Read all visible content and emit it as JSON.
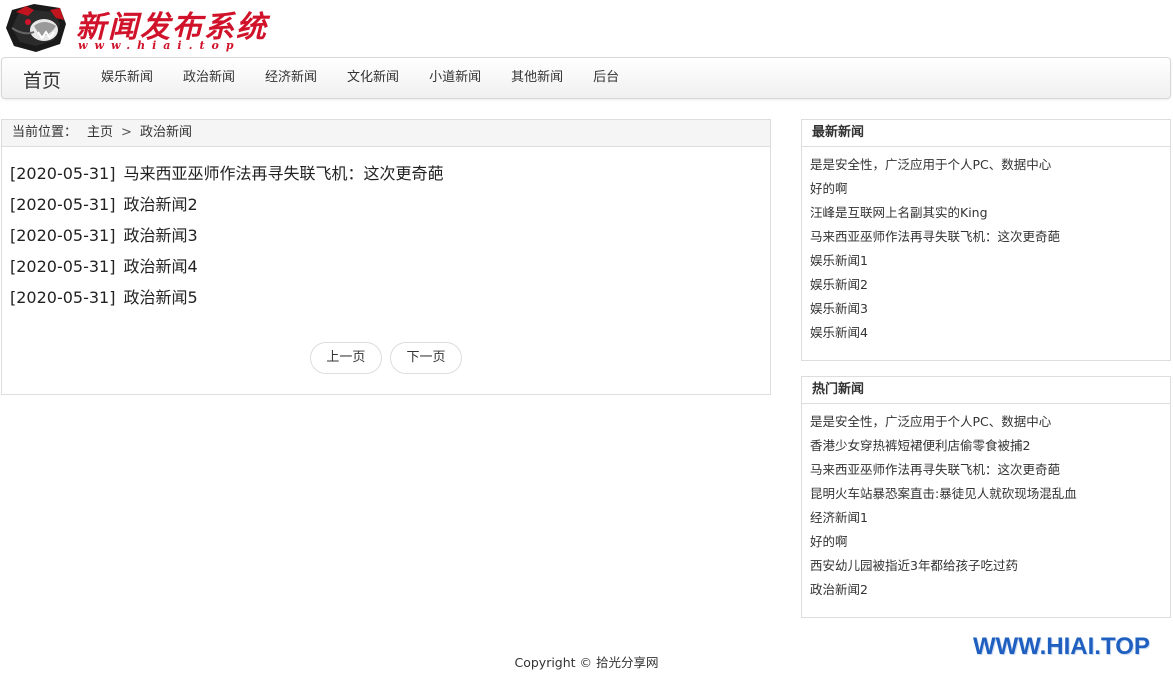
{
  "header": {
    "logo_title": "新闻发布系统",
    "logo_url": "www.hiai.top"
  },
  "navbar": {
    "brand": "首页",
    "items": [
      {
        "label": "娱乐新闻"
      },
      {
        "label": "政治新闻"
      },
      {
        "label": "经济新闻"
      },
      {
        "label": "文化新闻"
      },
      {
        "label": "小道新闻"
      },
      {
        "label": "其他新闻"
      },
      {
        "label": "后台"
      }
    ]
  },
  "breadcrumb": {
    "prefix": "当前位置：",
    "home": "主页",
    "separator": ">",
    "current": "政治新闻"
  },
  "news_list": [
    {
      "date": "[2020-05-31]",
      "title": "马来西亚巫师作法再寻失联飞机：这次更奇葩"
    },
    {
      "date": "[2020-05-31]",
      "title": "政治新闻2"
    },
    {
      "date": "[2020-05-31]",
      "title": "政治新闻3"
    },
    {
      "date": "[2020-05-31]",
      "title": "政治新闻4"
    },
    {
      "date": "[2020-05-31]",
      "title": "政治新闻5"
    }
  ],
  "pager": {
    "prev": "上一页",
    "next": "下一页"
  },
  "latest": {
    "heading": "最新新闻",
    "items": [
      "是是安全性，广泛应用于个人PC、数据中心",
      "好的啊",
      "汪峰是互联网上名副其实的King",
      "马来西亚巫师作法再寻失联飞机：这次更奇葩",
      "娱乐新闻1",
      "娱乐新闻2",
      "娱乐新闻3",
      "娱乐新闻4"
    ]
  },
  "hot": {
    "heading": "热门新闻",
    "items": [
      "是是安全性，广泛应用于个人PC、数据中心",
      "香港少女穿热裤短裙便利店偷零食被捕2",
      "马来西亚巫师作法再寻失联飞机：这次更奇葩",
      "昆明火车站暴恐案直击:暴徒见人就砍现场混乱血",
      "经济新闻1",
      "好的啊",
      "西安幼儿园被指近3年都给孩子吃过药",
      "政治新闻2"
    ]
  },
  "footer": {
    "copyright": "Copyright © 拾光分享网",
    "watermark": "WWW.HIAI.TOP"
  },
  "colors": {
    "logo_red": "#d0132a",
    "watermark_blue": "#1f5fbf",
    "border": "#dddddd"
  },
  "icons": {
    "logo": "panther-head-logo-icon"
  }
}
